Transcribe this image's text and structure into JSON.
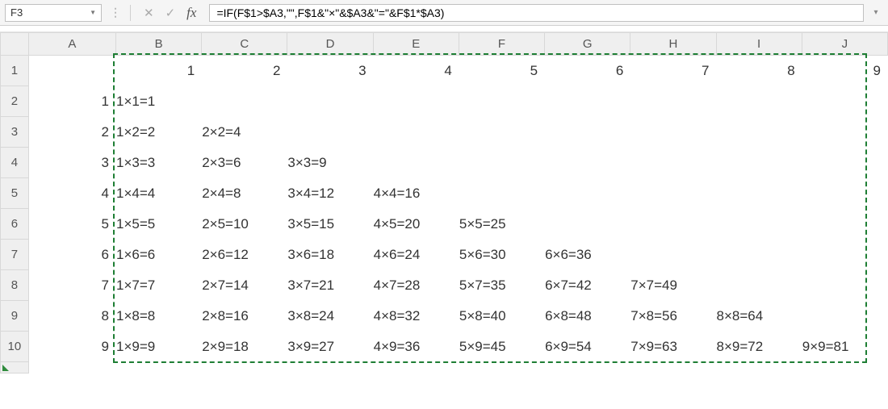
{
  "formula_bar": {
    "name_box": "F3",
    "cancel_glyph": "✕",
    "accept_glyph": "✓",
    "fx_label": "fx",
    "formula": "=IF(F$1>$A3,\"\",F$1&\"×\"&$A3&\"=\"&F$1*$A3)"
  },
  "columns": [
    "A",
    "B",
    "C",
    "D",
    "E",
    "F",
    "G",
    "H",
    "I",
    "J"
  ],
  "rows": [
    "1",
    "2",
    "3",
    "4",
    "5",
    "6",
    "7",
    "8",
    "9",
    "10"
  ],
  "header_numbers": [
    "1",
    "2",
    "3",
    "4",
    "5",
    "6",
    "7",
    "8",
    "9"
  ],
  "side_numbers": [
    "1",
    "2",
    "3",
    "4",
    "5",
    "6",
    "7",
    "8",
    "9"
  ],
  "table": {
    "r1": {
      "b": "1×1=1"
    },
    "r2": {
      "b": "1×2=2",
      "c": "2×2=4"
    },
    "r3": {
      "b": "1×3=3",
      "c": "2×3=6",
      "d": "3×3=9"
    },
    "r4": {
      "b": "1×4=4",
      "c": "2×4=8",
      "d": "3×4=12",
      "e": "4×4=16"
    },
    "r5": {
      "b": "1×5=5",
      "c": "2×5=10",
      "d": "3×5=15",
      "e": "4×5=20",
      "f": "5×5=25"
    },
    "r6": {
      "b": "1×6=6",
      "c": "2×6=12",
      "d": "3×6=18",
      "e": "4×6=24",
      "f": "5×6=30",
      "g": "6×6=36"
    },
    "r7": {
      "b": "1×7=7",
      "c": "2×7=14",
      "d": "3×7=21",
      "e": "4×7=28",
      "f": "5×7=35",
      "g": "6×7=42",
      "h": "7×7=49"
    },
    "r8": {
      "b": "1×8=8",
      "c": "2×8=16",
      "d": "3×8=24",
      "e": "4×8=32",
      "f": "5×8=40",
      "g": "6×8=48",
      "h": "7×8=56",
      "i": "8×8=64"
    },
    "r9": {
      "b": "1×9=9",
      "c": "2×9=18",
      "d": "3×9=27",
      "e": "4×9=36",
      "f": "5×9=45",
      "g": "6×9=54",
      "h": "7×9=63",
      "i": "8×9=72",
      "j": "9×9=81"
    }
  }
}
